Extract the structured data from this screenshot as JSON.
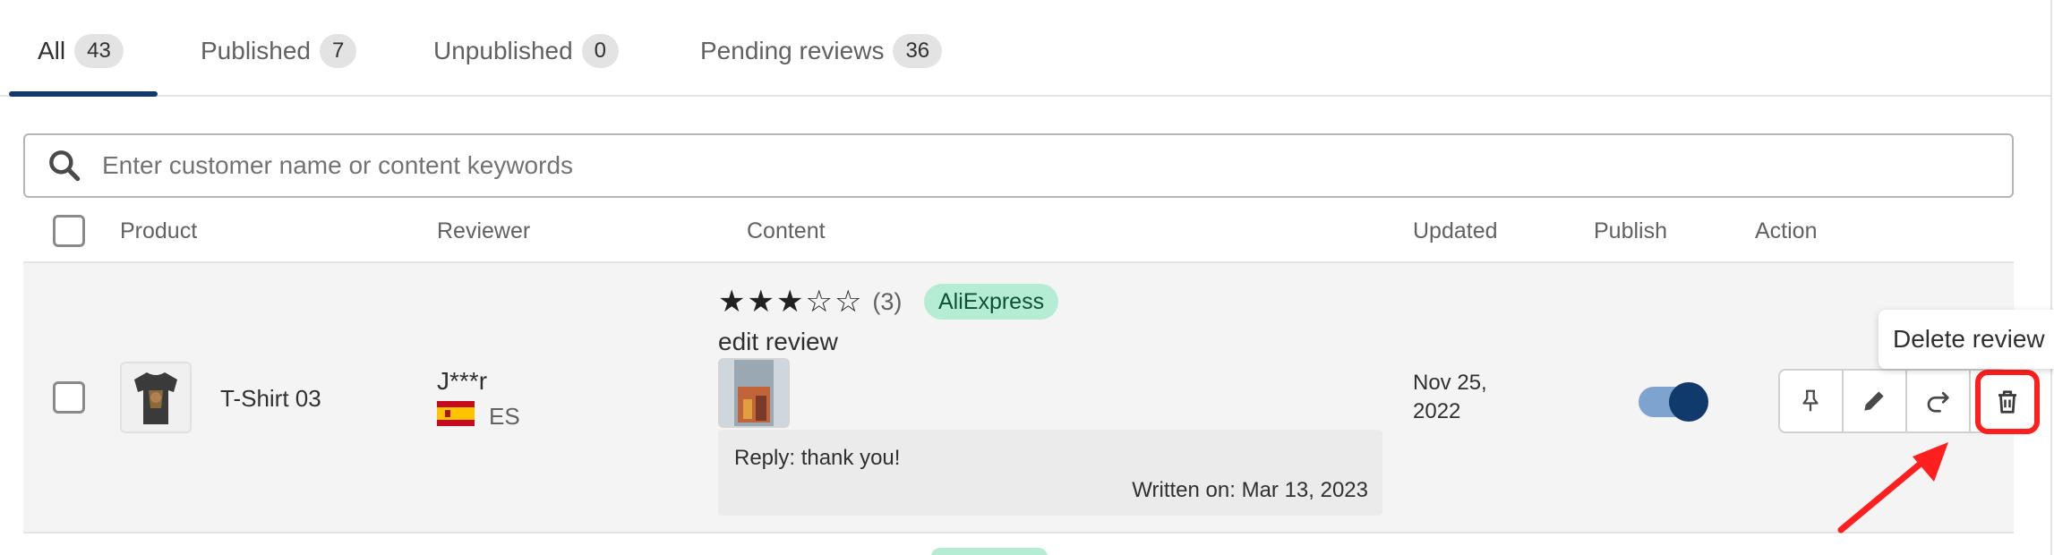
{
  "tabs": [
    {
      "label": "All",
      "count": "43"
    },
    {
      "label": "Published",
      "count": "7"
    },
    {
      "label": "Unpublished",
      "count": "0"
    },
    {
      "label": "Pending reviews",
      "count": "36"
    }
  ],
  "search": {
    "placeholder": "Enter customer name or content keywords",
    "icon": "search-icon"
  },
  "table": {
    "headers": {
      "product": "Product",
      "reviewer": "Reviewer",
      "content": "Content",
      "updated": "Updated",
      "publish": "Publish",
      "action": "Action"
    },
    "rows": [
      {
        "product": "T-Shirt 03",
        "reviewer": {
          "name": "J***r",
          "country": "ES"
        },
        "rating": 3,
        "rating_count": "(3)",
        "source_badge": "AliExpress",
        "review_text": "edit review",
        "reply": "Reply: thank you!",
        "written_on": "Written on: Mar 13, 2023",
        "updated_line1": "Nov 25,",
        "updated_line2": "2022",
        "published": true
      }
    ]
  },
  "actions": {
    "icons": [
      "pin-icon",
      "edit-icon",
      "share-icon",
      "trash-icon"
    ]
  },
  "tooltip": {
    "text": "Delete review"
  },
  "colors": {
    "accent": "#13386b",
    "toggle_on": "#0f3a6b",
    "badge_bg": "#b5ecd4",
    "highlight": "#ff1f1f"
  }
}
